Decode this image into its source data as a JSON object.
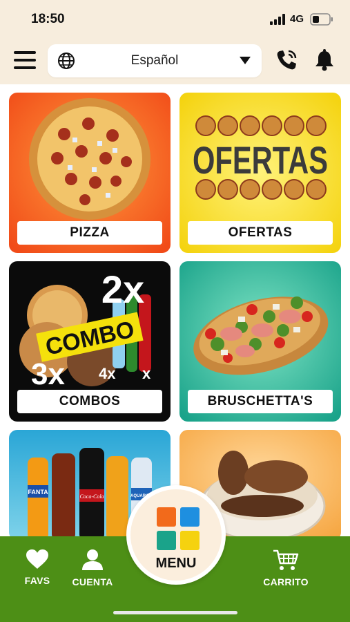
{
  "status": {
    "time": "18:50",
    "network": "4G"
  },
  "header": {
    "language": "Español"
  },
  "tiles": [
    {
      "label": "PIZZA"
    },
    {
      "label": "OFERTAS",
      "art_text": "OFERTAS"
    },
    {
      "label": "COMBOS",
      "art_combo": "COMBO",
      "art_2x": "2x",
      "art_3x": "3x",
      "art_4x": "4x",
      "art_x": "x"
    },
    {
      "label": "BRUSCHETTA'S"
    },
    {
      "label": "",
      "bottle_labels": [
        "FANTA",
        "Coca-Cola",
        "AQUARIUS"
      ]
    },
    {
      "label": ""
    }
  ],
  "nav": {
    "favs": "FAVS",
    "cuenta": "CUENTA",
    "menu": "MENU",
    "carrito": "CARRITO"
  },
  "colors": {
    "nav_green": "#4d8f16",
    "fab_blue": "#1e8fe0",
    "fab_orange": "#f26a1b",
    "fab_teal": "#1aa38a",
    "fab_yellow": "#f5d20f"
  }
}
